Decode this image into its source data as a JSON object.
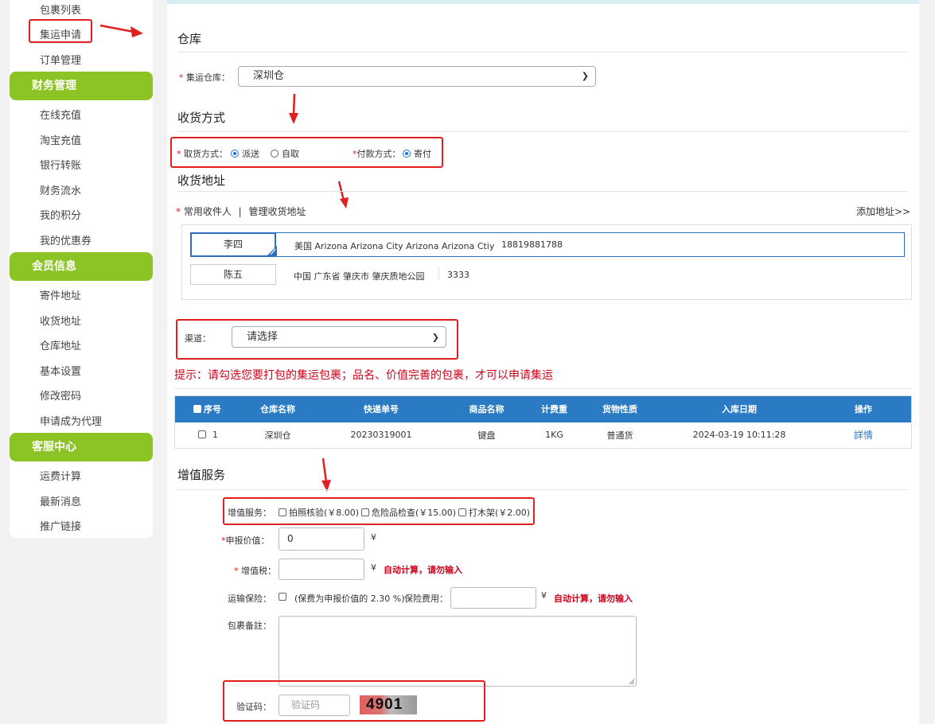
{
  "sidebar": {
    "top_items": [
      "包裹列表",
      "集运申请",
      "订单管理"
    ],
    "groups": [
      {
        "title": "财务管理",
        "items": [
          "在线充值",
          "淘宝充值",
          "银行转账",
          "财务流水",
          "我的积分",
          "我的优惠券"
        ]
      },
      {
        "title": "会员信息",
        "items": [
          "寄件地址",
          "收货地址",
          "仓库地址",
          "基本设置",
          "修改密码",
          "申请成为代理"
        ]
      },
      {
        "title": "客服中心",
        "items": [
          "运费计算",
          "最新消息",
          "推广链接"
        ]
      }
    ]
  },
  "warehouse": {
    "title": "仓库",
    "label": "集运仓库：",
    "value": "深圳仓"
  },
  "receive": {
    "title": "收货方式",
    "pickup_label": "取货方式：",
    "pickup_options": [
      "派送",
      "自取"
    ],
    "pay_label": "付款方式：",
    "pay_option": "寄付"
  },
  "address": {
    "title": "收货地址",
    "common_label": "常用收件人",
    "separator": "|",
    "manage_label": "管理收货地址",
    "add_label": "添加地址>>",
    "rows": [
      {
        "name": "李四",
        "addr": "美国 Arizona Arizona City Arizona Arizona Ctiy",
        "phone": "18819881788"
      },
      {
        "name": "陈五",
        "addr": "中国 广东省 肇庆市 肇庆质地公园",
        "phone": "3333"
      }
    ]
  },
  "channel": {
    "label": "渠道：",
    "value": "请选择"
  },
  "tip": "提示：请勾选您要打包的集运包裹；品名、价值完善的包裹，才可以申请集运",
  "table": {
    "headers": [
      "序号",
      "仓库名称",
      "快递单号",
      "商品名称",
      "计费重",
      "货物性质",
      "入库日期",
      "操作"
    ],
    "row": {
      "index": "1",
      "warehouse": "深圳仓",
      "tracking": "20230319001",
      "product": "键盘",
      "weight": "1KG",
      "nature": "普通货",
      "date": "2024-03-19 10:11:28",
      "action": "詳情"
    }
  },
  "services": {
    "title": "增值服务",
    "label": "增值服务：",
    "options": [
      "拍照核验(￥8.00)",
      "危险品检查(￥15.00)",
      "打木架(￥2.00)"
    ]
  },
  "form": {
    "declared_label": "申报价值：",
    "declared_value": "0",
    "currency": "¥",
    "tax_label": "增值税：",
    "auto_note": "自动计算，请勿输入",
    "insurance_label": "运输保险：",
    "insurance_text": "(保费为申报价值的 2.30 %)",
    "fee_label": "保险费用：",
    "remark_label": "包裹备註：",
    "captcha_label": "验证码：",
    "captcha_placeholder": "验证码",
    "captcha_code": "4901"
  }
}
